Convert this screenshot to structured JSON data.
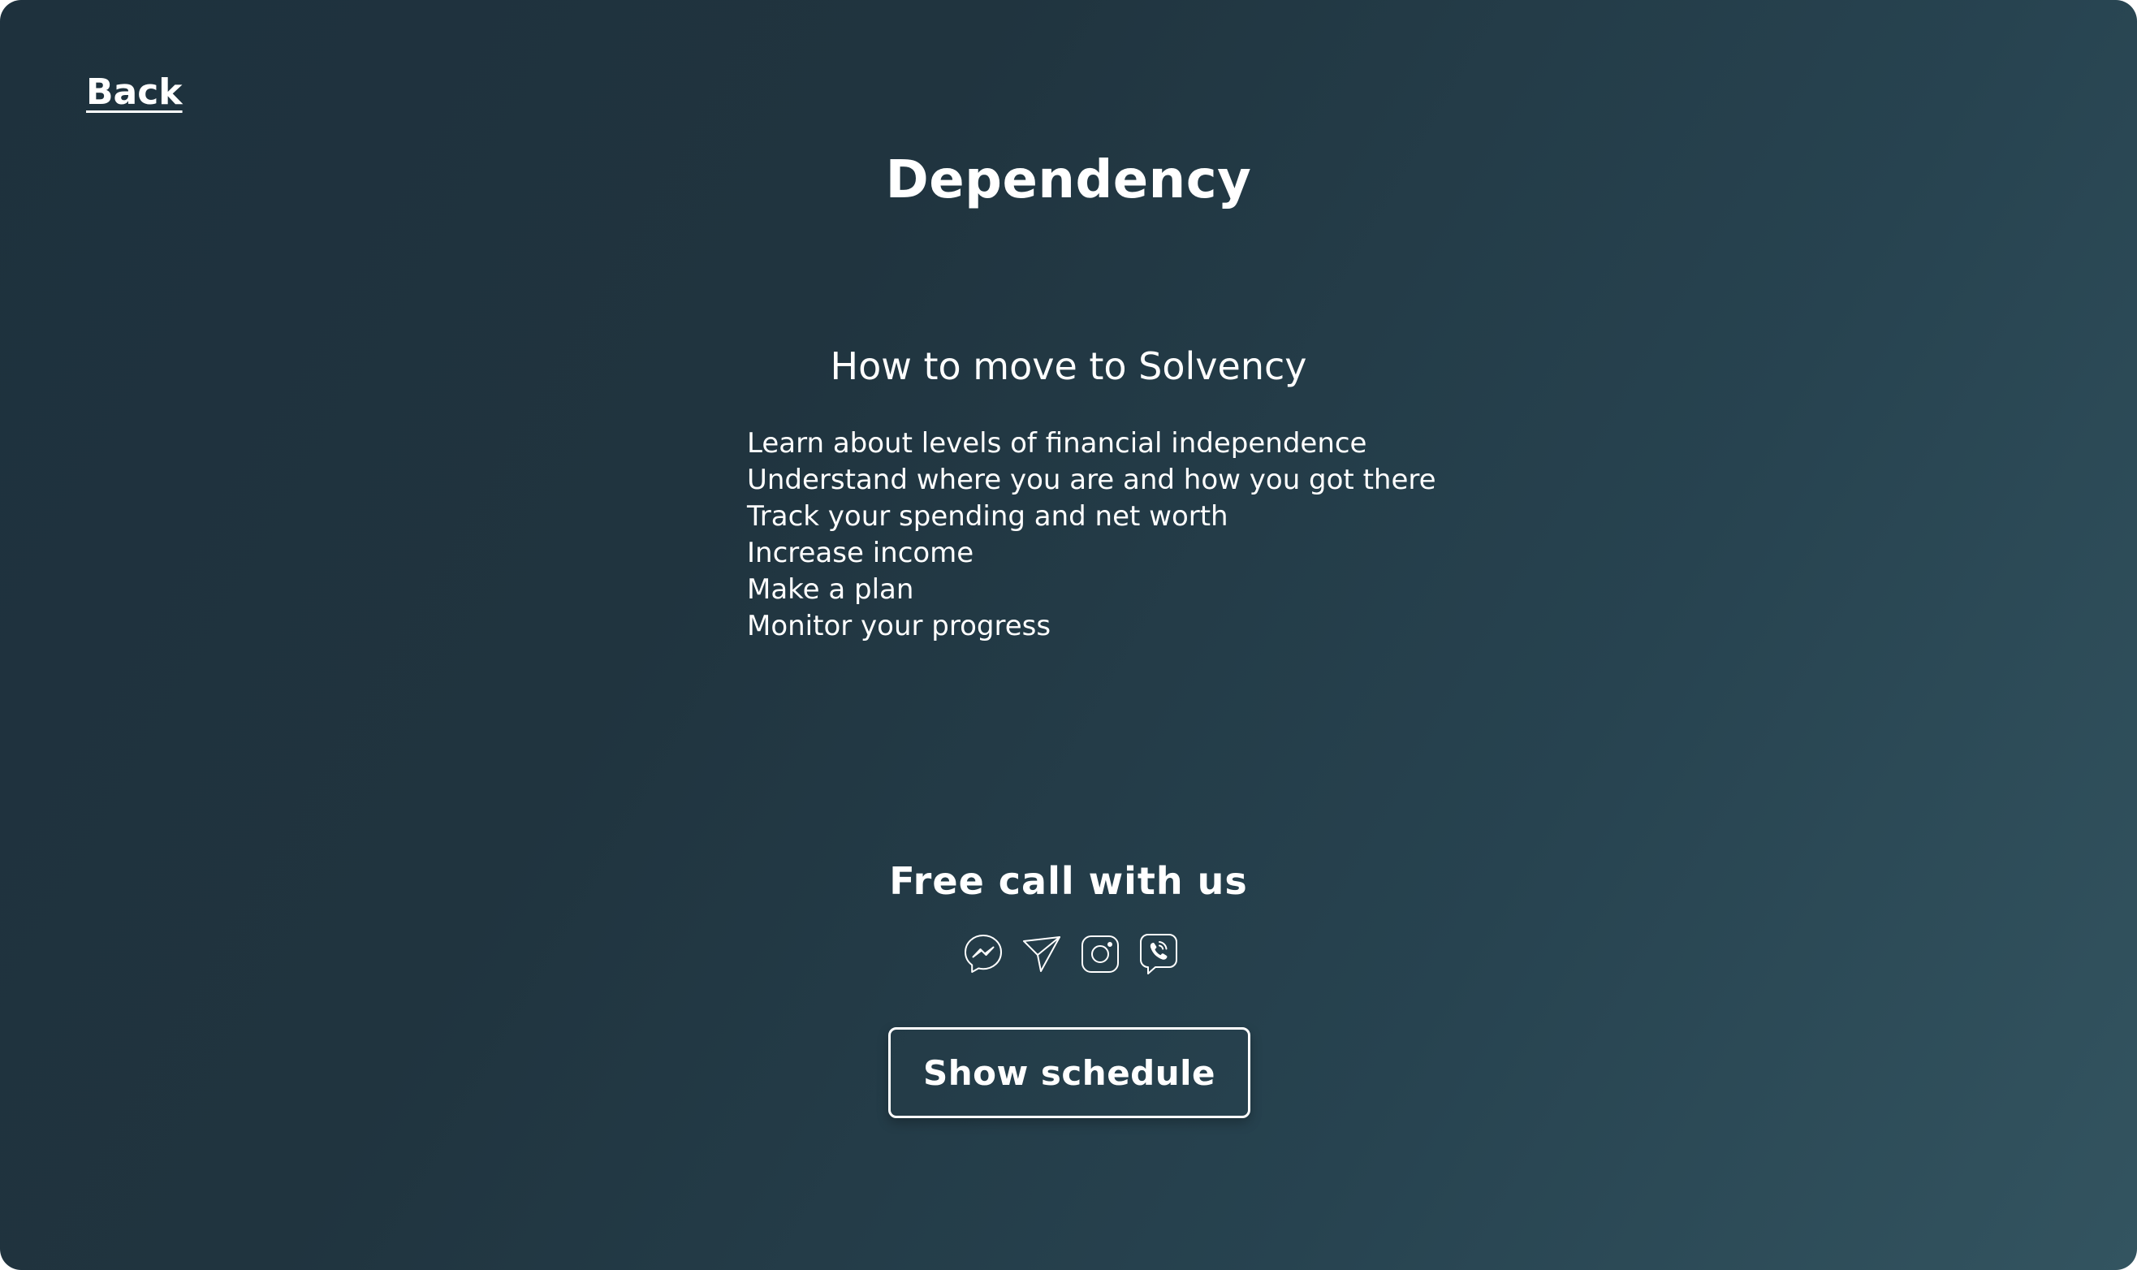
{
  "nav": {
    "back_label": "Back"
  },
  "page": {
    "title": "Dependency"
  },
  "section": {
    "title": "How to move to Solvency",
    "steps": [
      "Learn about levels of financial independence",
      "Understand where you are and how you got there",
      "Track your spending and net worth",
      "Increase income",
      "Make a plan",
      "Monitor your progress"
    ]
  },
  "contact": {
    "title": "Free call with us",
    "icons": [
      "messenger-icon",
      "telegram-icon",
      "instagram-icon",
      "viber-icon"
    ],
    "schedule_label": "Show schedule"
  },
  "colors": {
    "background_start": "#1e313d",
    "background_end": "#335460",
    "text": "#ffffff"
  }
}
